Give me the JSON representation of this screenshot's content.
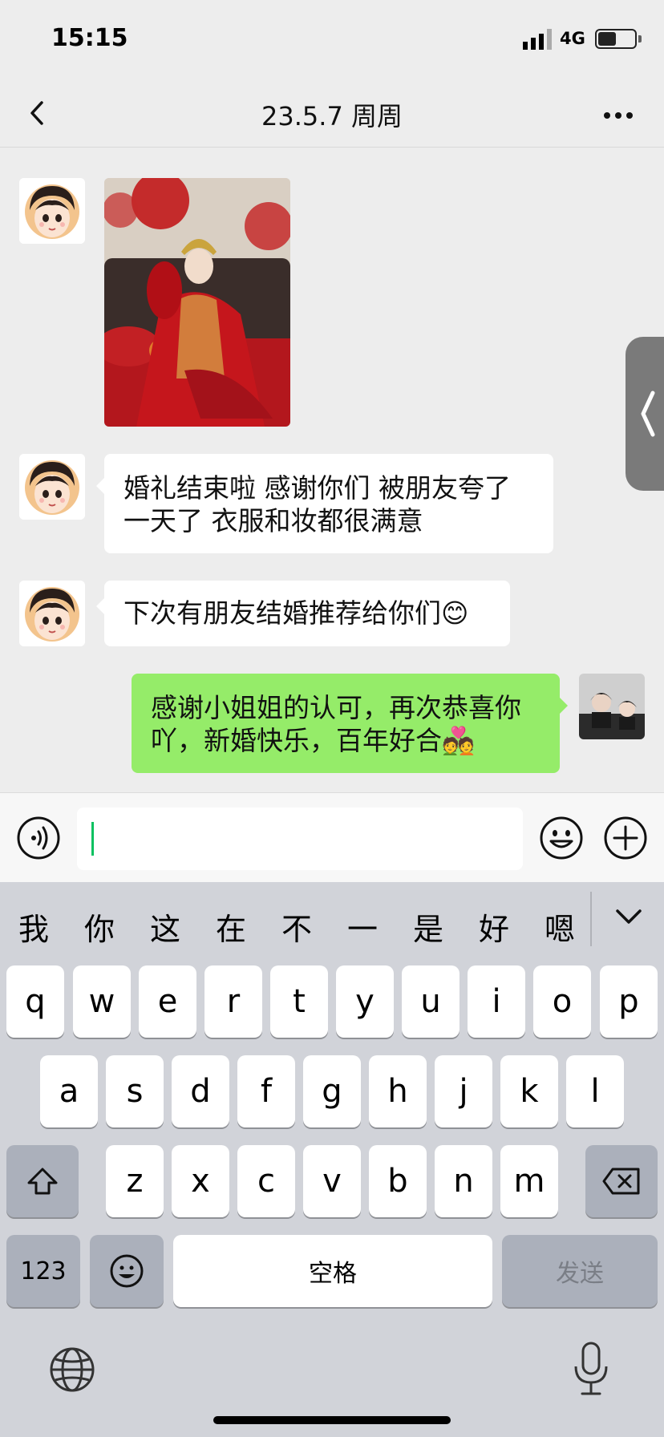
{
  "status_bar": {
    "time": "15:15",
    "network": "4G"
  },
  "nav": {
    "title": "23.5.7 周周"
  },
  "messages": [
    {
      "type": "image",
      "direction": "in"
    },
    {
      "type": "text",
      "direction": "in",
      "line1": "婚礼结束啦 感谢你们  被朋友夸了",
      "line2": "一天了 衣服和妆都很满意"
    },
    {
      "type": "text",
      "direction": "in",
      "line1": "下次有朋友结婚推荐给你们😊"
    },
    {
      "type": "text",
      "direction": "out",
      "line1": "感谢小姐姐的认可，再次恭喜你",
      "line2": "吖，新婚快乐，百年好合💑"
    }
  ],
  "input": {
    "placeholder": ""
  },
  "keyboard": {
    "candidates": [
      "我",
      "你",
      "这",
      "在",
      "不",
      "一",
      "是",
      "好",
      "嗯"
    ],
    "row1": [
      "q",
      "w",
      "e",
      "r",
      "t",
      "y",
      "u",
      "i",
      "o",
      "p"
    ],
    "row2": [
      "a",
      "s",
      "d",
      "f",
      "g",
      "h",
      "j",
      "k",
      "l"
    ],
    "row3": [
      "z",
      "x",
      "c",
      "v",
      "b",
      "n",
      "m"
    ],
    "num_label": "123",
    "space_label": "空格",
    "send_label": "发送"
  },
  "colors": {
    "accent_green": "#07c160",
    "bubble_out": "#95ec69",
    "bubble_in": "#ffffff",
    "bg": "#ededed"
  }
}
